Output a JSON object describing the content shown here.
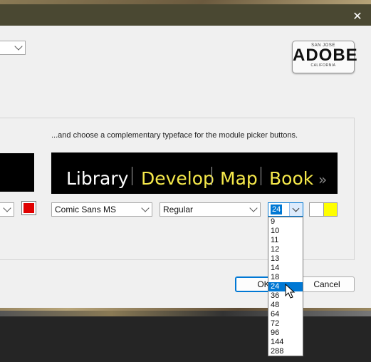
{
  "window": {
    "close_glyph": "✕"
  },
  "plate": {
    "top": "SAN JOSE",
    "main": "ADOBE",
    "bottom": "CALIFORNIA"
  },
  "description": "...and choose a complementary typeface for the module picker buttons.",
  "modules": [
    {
      "label": "Library",
      "color": "#ffffff"
    },
    {
      "label": "Develop",
      "color": "#f5e84a"
    },
    {
      "label": "Map",
      "color": "#f5e84a"
    },
    {
      "label": "Book",
      "color": "#f5e84a"
    }
  ],
  "more_glyph": "»",
  "font_select": {
    "value": "Comic Sans MS"
  },
  "style_select": {
    "value": "Regular"
  },
  "size_input": {
    "value": "24"
  },
  "size_options": [
    "9",
    "10",
    "11",
    "12",
    "13",
    "14",
    "18",
    "24",
    "36",
    "48",
    "64",
    "72",
    "96",
    "144",
    "288"
  ],
  "size_selected": "24",
  "colors": {
    "left_swatch": "#e00000",
    "swatch_a": "#ffffff",
    "swatch_b": "#ffff00"
  },
  "buttons": {
    "ok": "OK",
    "cancel": "Cancel"
  }
}
